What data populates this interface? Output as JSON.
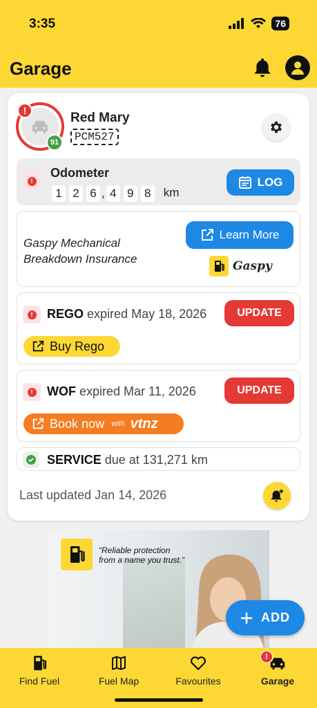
{
  "status_bar": {
    "time": "3:35",
    "battery": "76"
  },
  "header": {
    "title": "Garage"
  },
  "vehicle": {
    "name": "Red Mary",
    "plate": "PCM527",
    "score": "91",
    "alert": "!"
  },
  "odometer": {
    "title": "Odometer",
    "digits": [
      "1",
      "2",
      "6",
      "4",
      "9",
      "8"
    ],
    "separator": ",",
    "unit": "km",
    "log_label": "LOG"
  },
  "insurance": {
    "line1": "Gaspy Mechanical",
    "line2": "Breakdown Insurance",
    "learn_more": "Learn More",
    "brand": "Gaspy"
  },
  "rego": {
    "label": "REGO",
    "status": "expired May 18, 2026",
    "update": "UPDATE",
    "action": "Buy Rego"
  },
  "wof": {
    "label": "WOF",
    "status": "expired Mar 11, 2026",
    "update": "UPDATE",
    "action": "Book now",
    "with": "with",
    "brand": "vtnz"
  },
  "service": {
    "label": "SERVICE",
    "status": "due at 131,271 km"
  },
  "last_updated": "Last updated Jan 14, 2026",
  "ad": {
    "quote_line1": "“Reliable protection",
    "quote_line2": "from a name you trust.”"
  },
  "fab": {
    "label": "ADD"
  },
  "nav": {
    "items": [
      {
        "label": "Find Fuel"
      },
      {
        "label": "Fuel Map"
      },
      {
        "label": "Favourites"
      },
      {
        "label": "Garage"
      }
    ]
  },
  "colors": {
    "brand_yellow": "#fdd835",
    "action_blue": "#1e88e5",
    "alert_red": "#e53935",
    "ok_green": "#43a047",
    "vtnz_orange": "#f57c20"
  }
}
